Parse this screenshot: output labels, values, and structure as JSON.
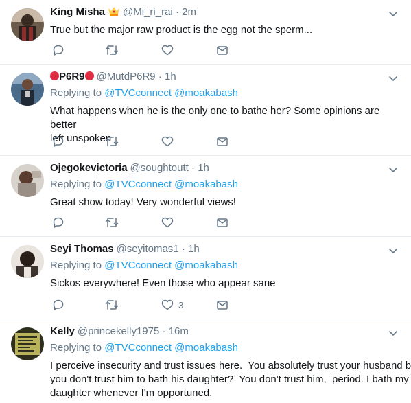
{
  "tweets": [
    {
      "name": "King Misha",
      "name_suffix_emoji": "crown-emoji",
      "handle": "@Mi_ri_rai",
      "separator": "·",
      "time": "2m",
      "replying_to": null,
      "text": "True but the major raw product is the egg not the sperm...",
      "like_count": ""
    },
    {
      "name_prefix_emoji": "red-circle-emoji",
      "name": "P6R9",
      "name_suffix_emoji": "red-circle-emoji",
      "handle": "@MutdP6R9",
      "separator": "·",
      "time": "1h",
      "replying_label": "Replying to",
      "mentions": [
        "@TVCconnect",
        "@moakabash"
      ],
      "text_lines": [
        "What happens when he is the only one to bathe her? Some opinions are better",
        "left unspoken"
      ],
      "like_count": ""
    },
    {
      "name": "Ojegokevictoria",
      "handle": "@soughtoutt",
      "separator": "·",
      "time": "1h",
      "replying_label": "Replying to",
      "mentions": [
        "@TVCconnect",
        "@moakabash"
      ],
      "text": "Great show today! Very wonderful views!",
      "like_count": ""
    },
    {
      "name": "Seyi Thomas",
      "handle": "@seyitomas1",
      "separator": "·",
      "time": "1h",
      "replying_label": "Replying to",
      "mentions": [
        "@TVCconnect",
        "@moakabash"
      ],
      "text": "Sickos everywhere! Even those who appear sane",
      "like_count": "3"
    },
    {
      "name": "Kelly",
      "handle": "@princekelly1975",
      "separator": "·",
      "time": "16m",
      "replying_label": "Replying to",
      "mentions": [
        "@TVCconnect",
        "@moakabash"
      ],
      "text_lines": [
        "I perceive insecurity and trust issues here.  You absolutely trust your husband but",
        "you don't trust him to bath his daughter?  You don't trust him,  period. I bath my",
        "daughter whenever I'm opportuned."
      ],
      "like_count": ""
    }
  ],
  "icons": {
    "reply": "reply-icon",
    "retweet": "retweet-icon",
    "like": "like-icon",
    "dm": "direct-message-icon",
    "more": "chevron-down-icon"
  },
  "colors": {
    "link": "#1da1f2",
    "secondary_text": "#657786",
    "primary_text": "#14171a",
    "divider": "#e6ecf0",
    "red_circle": "#dd2e44"
  }
}
